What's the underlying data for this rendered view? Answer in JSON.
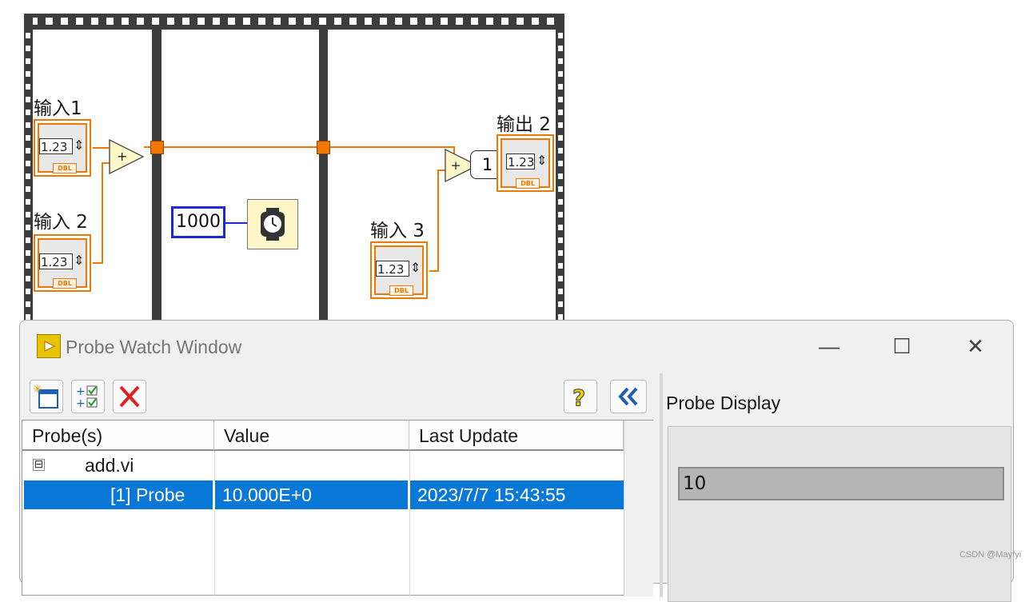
{
  "diagram": {
    "input1_label": "输入1",
    "input2_label": "输入 2",
    "input3_label": "输入 3",
    "output2_label": "输出 2",
    "numeric_display": "1.23",
    "type_badge": "DBL",
    "wait_constant": "1000",
    "probe_tag": "1",
    "add_symbol": "+"
  },
  "probe_window": {
    "title": "Probe Watch Window",
    "window_controls": {
      "minimize": "—",
      "maximize": "☐",
      "close": "✕"
    },
    "toolbar": {
      "new_probe_icon": "new-window-icon",
      "select_probes_icon": "checklist-icon",
      "delete_icon": "red-x-icon",
      "help_icon": "help-icon",
      "collapse_icon": "double-chevron-left-icon"
    },
    "columns": [
      "Probe(s)",
      "Value",
      "Last Update"
    ],
    "tree_toggle": "⊟",
    "tree_parent": "add.vi",
    "rows": [
      {
        "probe": "[1] Probe",
        "value": "10.000E+0",
        "last_update": "2023/7/7 15:43:55"
      }
    ],
    "probe_display_label": "Probe Display",
    "probe_display_value": "10"
  },
  "watermark": "CSDN @Mayfyi",
  "colors": {
    "wire_orange": "#f07800",
    "constant_blue": "#1a2ad4",
    "selection_blue": "#0a78d7",
    "frame_dark": "#3d3d3d"
  }
}
